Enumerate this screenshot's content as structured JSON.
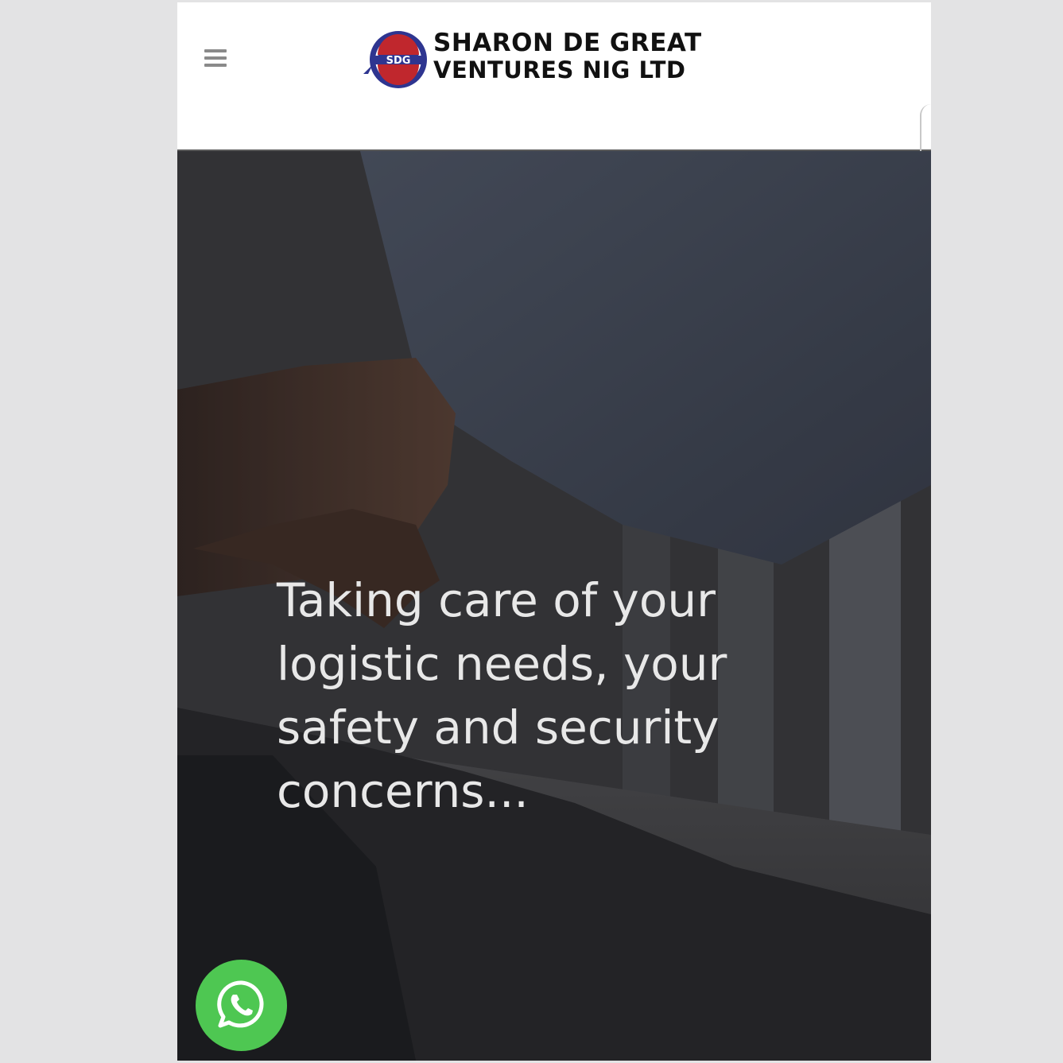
{
  "header": {
    "menu_icon": "hamburger-menu-icon",
    "logo": {
      "mark_letters": "SDG",
      "line1": "SHARON DE GREAT",
      "line2": "VENTURES NIG LTD"
    }
  },
  "hero": {
    "tagline": "Taking care of your logistic needs, your safety and security concerns..."
  },
  "floating": {
    "whatsapp_icon": "whatsapp-icon"
  },
  "colors": {
    "whatsapp_green": "#4ec752",
    "logo_blue": "#2e3590",
    "logo_red": "#c0272d",
    "tagline_text": "#e8e8e8"
  }
}
